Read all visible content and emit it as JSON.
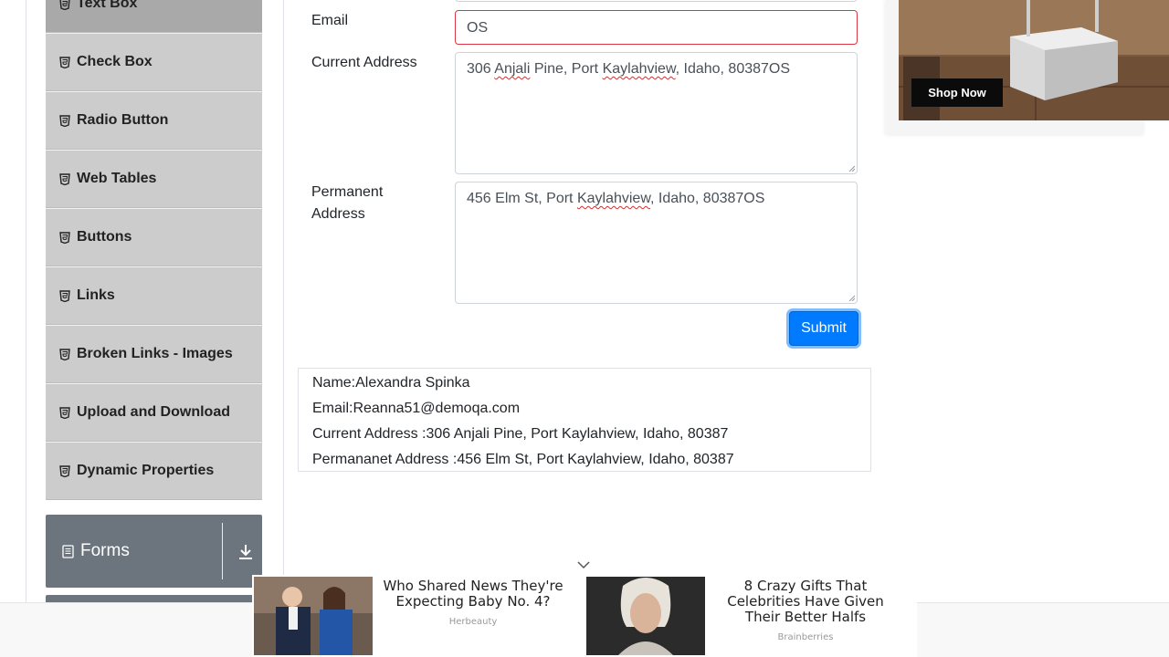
{
  "sidebar": {
    "items": [
      {
        "label": "Text Box",
        "active": true
      },
      {
        "label": "Check Box"
      },
      {
        "label": "Radio Button"
      },
      {
        "label": "Web Tables"
      },
      {
        "label": "Buttons"
      },
      {
        "label": "Links"
      },
      {
        "label": "Broken Links - Images"
      },
      {
        "label": "Upload and Download"
      },
      {
        "label": "Dynamic Properties"
      }
    ],
    "group": {
      "label": "Forms",
      "icon": "document-icon",
      "toggle_icon": "download-arrow-icon"
    }
  },
  "form": {
    "email": {
      "label": "Email",
      "value": "OS",
      "state": "error"
    },
    "current_address": {
      "label": "Current Address",
      "value_parts": [
        "306 ",
        "Anjali",
        " Pine, Port ",
        "Kaylahview",
        ", Idaho, 80387OS"
      ]
    },
    "permanent_address": {
      "label_line1": "Permanent",
      "label_line2": "Address",
      "value_parts": [
        "456 Elm St, Port ",
        "Kaylahview",
        ", Idaho, 80387OS"
      ]
    },
    "submit_label": "Submit"
  },
  "output": {
    "name": "Name:Alexandra Spinka",
    "email": "Email:Reanna51@demoqa.com",
    "current_address": "Current Address :306 Anjali Pine, Port Kaylahview, Idaho, 80387",
    "permanent_address": "Permananet Address :456 Elm St, Port Kaylahview, Idaho, 80387"
  },
  "side_ad": {
    "cta": "Shop Now"
  },
  "bottom_ads": [
    {
      "title": "Who Shared News They're Expecting Baby No. 4?",
      "source": "Herbeauty"
    },
    {
      "title": "8 Crazy Gifts That Celebrities Have Given Their Better Halfs",
      "source": "Brainberries"
    }
  ],
  "colors": {
    "accent": "#007bff",
    "error": "#dc3545",
    "menu": "#cccccc",
    "group_header": "#6c757d"
  }
}
